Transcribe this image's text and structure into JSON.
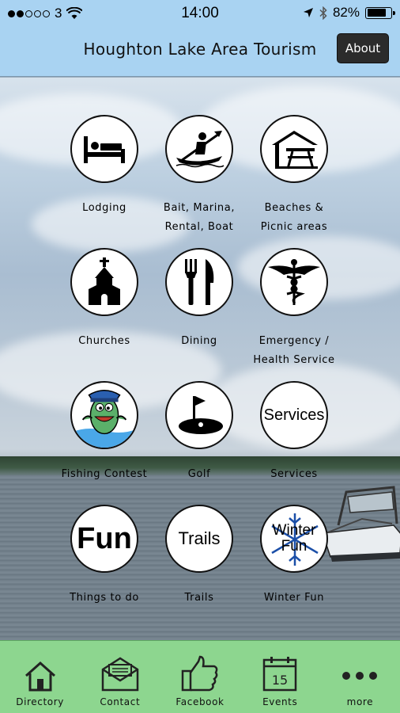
{
  "status_bar": {
    "carrier": "3",
    "time": "14:00",
    "battery": "82%",
    "battery_level": 0.82
  },
  "nav": {
    "title": "Houghton Lake Area Tourism",
    "about_label": "About"
  },
  "tiles": [
    {
      "label": "Lodging",
      "icon": "bed-icon"
    },
    {
      "label": "Bait, Marina, Rental, Boat",
      "icon": "kayak-icon"
    },
    {
      "label": "Beaches & Picnic areas",
      "icon": "picnic-table-icon"
    },
    {
      "label": "Churches",
      "icon": "church-icon"
    },
    {
      "label": "Dining",
      "icon": "fork-knife-icon"
    },
    {
      "label": "Emergency / Health Service",
      "icon": "caduceus-icon"
    },
    {
      "label": "Fishing Contest",
      "icon": "fish-cartoon-icon"
    },
    {
      "label": "Golf",
      "icon": "golf-flag-icon"
    },
    {
      "label": "Services",
      "icon": "services-text-icon",
      "circle_text": "Services"
    },
    {
      "label": "Things to do",
      "icon": "fun-text-icon",
      "circle_text": "Fun"
    },
    {
      "label": "Trails",
      "icon": "trails-text-icon",
      "circle_text": "Trails"
    },
    {
      "label": "Winter Fun",
      "icon": "snowflake-icon",
      "circle_text_1": "Winter",
      "circle_text_2": "Fun"
    }
  ],
  "tab_bar": [
    {
      "label": "Directory",
      "icon": "house-icon"
    },
    {
      "label": "Contact",
      "icon": "envelope-icon"
    },
    {
      "label": "Facebook",
      "icon": "thumbs-up-icon"
    },
    {
      "label": "Events",
      "icon": "calendar-icon",
      "calendar_day": "15"
    },
    {
      "label": "more",
      "icon": "more-dots-icon"
    }
  ]
}
